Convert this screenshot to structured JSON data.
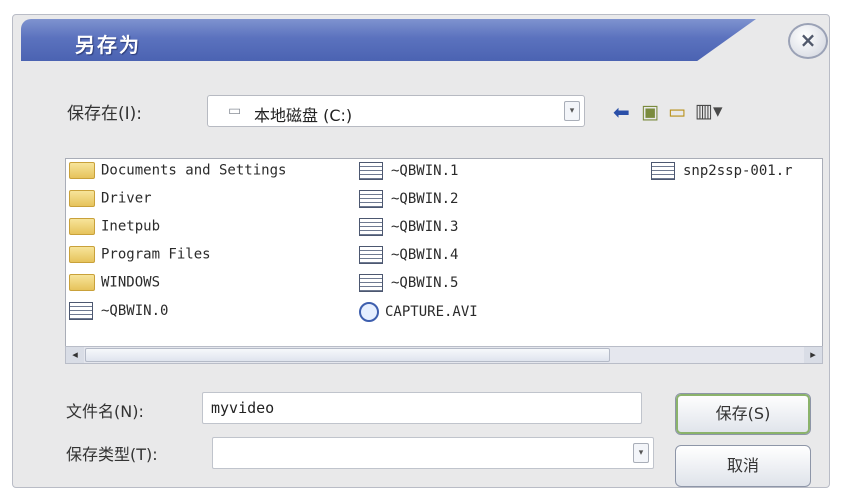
{
  "dialog": {
    "title": "另存为",
    "close_glyph": "×"
  },
  "save_in": {
    "label": "保存在(I):",
    "location": "本地磁盘 (C:)",
    "dropdown_glyph": "▾"
  },
  "toolbar": {
    "back_icon": "back-arrow-icon",
    "up_icon": "up-folder-icon",
    "new_folder_icon": "new-folder-icon",
    "views_icon": "views-menu-icon"
  },
  "files": {
    "column1": [
      {
        "name": "Documents and Settings",
        "icon": "folder-icon"
      },
      {
        "name": "Driver",
        "icon": "folder-icon"
      },
      {
        "name": "Inetpub",
        "icon": "folder-icon"
      },
      {
        "name": "Program Files",
        "icon": "folder-icon"
      },
      {
        "name": "WINDOWS",
        "icon": "folder-icon"
      },
      {
        "name": "~QBWIN.0",
        "icon": "document-icon"
      }
    ],
    "column2": [
      {
        "name": "~QBWIN.1",
        "icon": "document-icon"
      },
      {
        "name": "~QBWIN.2",
        "icon": "document-icon"
      },
      {
        "name": "~QBWIN.3",
        "icon": "document-icon"
      },
      {
        "name": "~QBWIN.4",
        "icon": "document-icon"
      },
      {
        "name": "~QBWIN.5",
        "icon": "document-icon"
      },
      {
        "name": "CAPTURE.AVI",
        "icon": "media-file-icon"
      }
    ],
    "column3": [
      {
        "name": "snp2ssp-001.r",
        "icon": "document-icon"
      }
    ]
  },
  "scrollbar": {
    "left_glyph": "◂",
    "right_glyph": "▸"
  },
  "filename": {
    "label": "文件名(N):",
    "value": "myvideo"
  },
  "filetype": {
    "label": "保存类型(T):",
    "value": "",
    "dropdown_glyph": "▾"
  },
  "buttons": {
    "save": "保存(S)",
    "cancel": "取消"
  }
}
